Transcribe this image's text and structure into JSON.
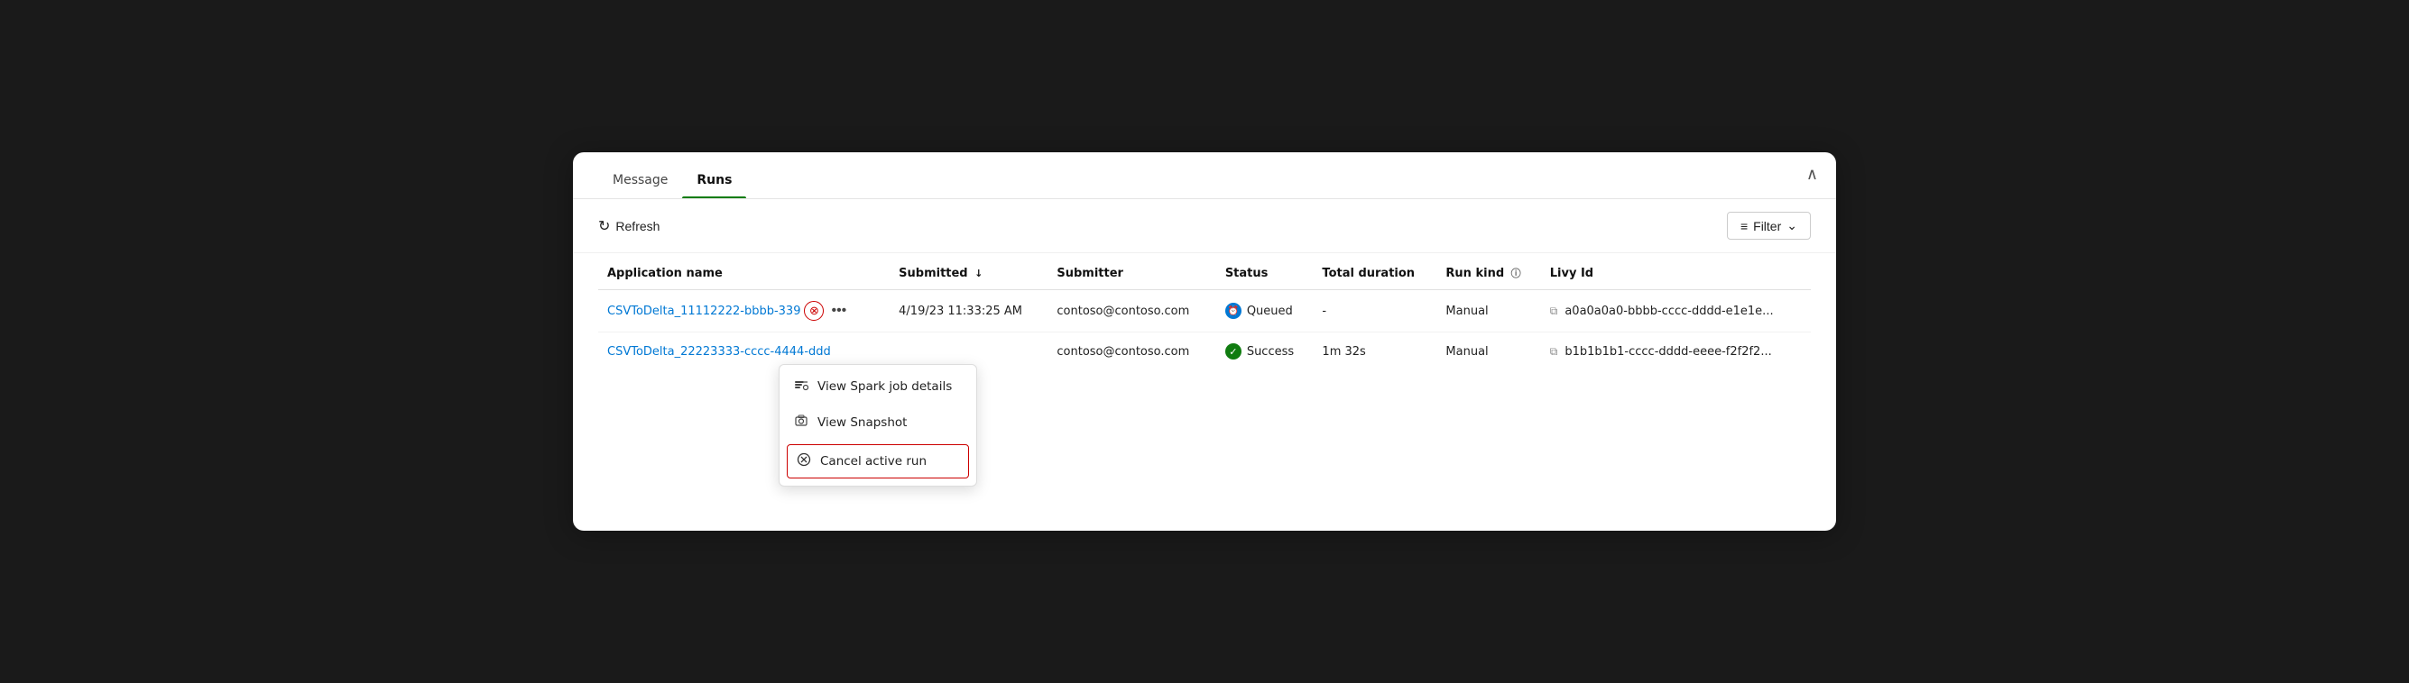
{
  "tabs": [
    {
      "id": "message",
      "label": "Message",
      "active": false
    },
    {
      "id": "runs",
      "label": "Runs",
      "active": true
    }
  ],
  "toolbar": {
    "refresh_label": "Refresh",
    "filter_label": "Filter"
  },
  "table": {
    "columns": [
      {
        "id": "app_name",
        "label": "Application name"
      },
      {
        "id": "submitted",
        "label": "Submitted",
        "sort": "↓"
      },
      {
        "id": "submitter",
        "label": "Submitter"
      },
      {
        "id": "status",
        "label": "Status"
      },
      {
        "id": "duration",
        "label": "Total duration"
      },
      {
        "id": "run_kind",
        "label": "Run kind",
        "info": true
      },
      {
        "id": "livy_id",
        "label": "Livy Id"
      }
    ],
    "rows": [
      {
        "app_name": "CSVToDelta_11112222-bbbb-339",
        "submitted": "4/19/23 11:33:25 AM",
        "submitter": "contoso@contoso.com",
        "status": "Queued",
        "status_type": "queued",
        "duration": "-",
        "run_kind": "Manual",
        "livy_id": "a0a0a0a0-bbbb-cccc-dddd-e1e1e...",
        "has_actions": true
      },
      {
        "app_name": "CSVToDelta_22223333-cccc-4444-ddd",
        "submitted": "",
        "submitter": "contoso@contoso.com",
        "status": "Success",
        "status_type": "success",
        "duration": "1m 32s",
        "run_kind": "Manual",
        "livy_id": "b1b1b1b1-cccc-dddd-eeee-f2f2f2...",
        "has_actions": false
      }
    ]
  },
  "dropdown": {
    "items": [
      {
        "id": "view-spark",
        "label": "View Spark job details",
        "icon": "spark"
      },
      {
        "id": "view-snapshot",
        "label": "View Snapshot",
        "icon": "snapshot"
      },
      {
        "id": "cancel-run",
        "label": "Cancel active run",
        "icon": "cancel",
        "highlighted": true
      }
    ]
  },
  "icons": {
    "collapse": "∧",
    "refresh": "↻",
    "filter": "≡",
    "chevron_down": "⌄",
    "close_circle": "⊗",
    "more": "···",
    "copy": "⧉",
    "check": "✓",
    "clock": "🕐",
    "spark": "⚡",
    "snapshot": "📷",
    "cancel_circle": "⊗",
    "info": "ⓘ"
  }
}
